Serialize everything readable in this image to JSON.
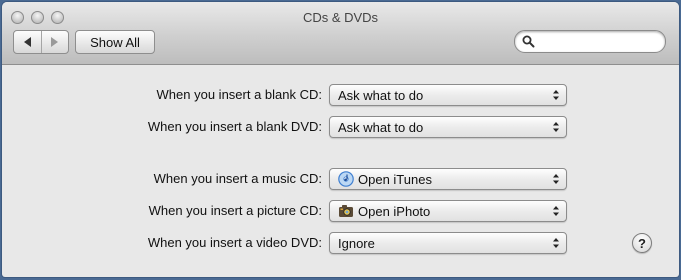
{
  "window": {
    "title": "CDs & DVDs"
  },
  "toolbar": {
    "show_all_label": "Show All"
  },
  "search": {
    "value": "",
    "placeholder": ""
  },
  "settings": [
    {
      "label": "When you insert a blank CD:",
      "value": "Ask what to do",
      "icon": ""
    },
    {
      "label": "When you insert a blank DVD:",
      "value": "Ask what to do",
      "icon": ""
    },
    {
      "label": "When you insert a music CD:",
      "value": "Open iTunes",
      "icon": "itunes-icon"
    },
    {
      "label": "When you insert a picture CD:",
      "value": "Open iPhoto",
      "icon": "iphoto-icon"
    },
    {
      "label": "When you insert a video DVD:",
      "value": "Ignore",
      "icon": ""
    }
  ],
  "help": {
    "label": "?"
  },
  "colors": {
    "desktop": "#4a6a93",
    "panel": "#e8e8e8",
    "itunes": "#3f7fd0",
    "iphoto": "#5a4a36"
  }
}
